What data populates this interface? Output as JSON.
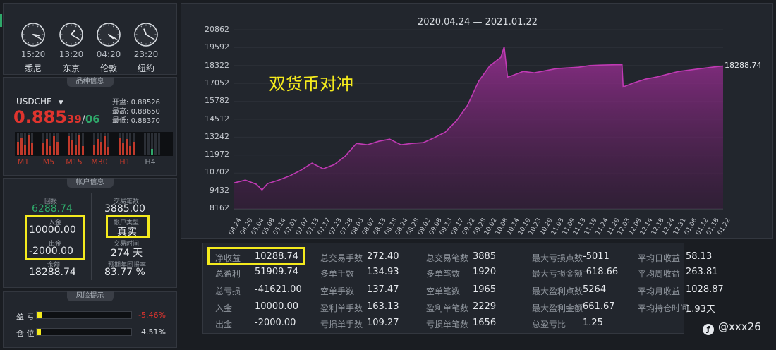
{
  "clocks": [
    {
      "time": "15:20",
      "city": "悉尼",
      "hour": 15,
      "minute": 20
    },
    {
      "time": "13:20",
      "city": "东京",
      "hour": 13,
      "minute": 20
    },
    {
      "time": "04:20",
      "city": "伦敦",
      "hour": 4,
      "minute": 20
    },
    {
      "time": "23:20",
      "city": "纽约",
      "hour": 23,
      "minute": 20
    }
  ],
  "symbol_section": {
    "title": "品种信息",
    "symbol": "USDCHF",
    "price_big": "0.885",
    "price_small": "39",
    "price_sep": "/",
    "price_spread": "06",
    "open_label": "开盘:",
    "open_value": "0.88526",
    "high_label": "最高:",
    "high_value": "0.88650",
    "low_label": "最低:",
    "low_value": "0.88370",
    "timeframes": [
      "M1",
      "M5",
      "M15",
      "M30",
      "H1",
      "H4"
    ]
  },
  "account_section": {
    "title": "帐户信息",
    "return_label": "回报",
    "return_value": "6288.74",
    "trades_label": "交易笔数",
    "trades_value": "3885.00",
    "deposit_label": "入金",
    "deposit_value": "10000.00",
    "account_type_label": "帐户类型",
    "account_type_value": "真实",
    "withdraw_label": "出金",
    "withdraw_value": "-2000.00",
    "duration_label": "交易时间",
    "duration_value": "274 天",
    "balance_label": "余额",
    "balance_value": "18288.74",
    "annual_label": "预期年回报率",
    "annual_value": "83.77 %"
  },
  "risk_section": {
    "title": "风险提示",
    "items": [
      {
        "label": "盈 亏",
        "value": "-5.46%",
        "fraction": 0.0546,
        "color": "#e0342e"
      },
      {
        "label": "仓 位",
        "value": "4.51%",
        "fraction": 0.0451,
        "color": "#d7dbe0"
      }
    ]
  },
  "chart_title": "2020.04.24 — 2021.01.22",
  "chart_overlay_text": "双货币对冲",
  "chart_data": {
    "type": "area",
    "title": "2020.04.24 — 2021.01.22",
    "yticks": [
      "20862",
      "19592",
      "18322",
      "17052",
      "15782",
      "14512",
      "13242",
      "11972",
      "10702",
      "9432",
      "8162"
    ],
    "ylim": [
      8162,
      20862
    ],
    "last_value_label": "18288.74",
    "xticks": [
      "04.24",
      "04.29",
      "05.04",
      "05.08",
      "05.14",
      "07.01",
      "07.07",
      "07.13",
      "07.17",
      "07.23",
      "07.28",
      "08.03",
      "08.07",
      "08.13",
      "08.18",
      "08.24",
      "08.28",
      "09.02",
      "09.08",
      "09.13",
      "09.17",
      "09.22",
      "09.28",
      "10.02",
      "10.08",
      "10.14",
      "10.19",
      "10.23",
      "10.29",
      "11.03",
      "11.09",
      "11.13",
      "11.19",
      "11.24",
      "11.29",
      "12.03",
      "12.09",
      "12.14",
      "12.18",
      "12.24",
      "12.31",
      "01.06",
      "01.12",
      "01.18",
      "01.22"
    ],
    "x": [
      0,
      1,
      2,
      2.5,
      3,
      4,
      5,
      6,
      7,
      8,
      9,
      10,
      11,
      12,
      13,
      14,
      15,
      16,
      17,
      18,
      19,
      20,
      21,
      22,
      23,
      24,
      24.3,
      24.6,
      25,
      26,
      27,
      28,
      29,
      30,
      31,
      32,
      33,
      34,
      34.9,
      35,
      36,
      37,
      38,
      39,
      40,
      41,
      42,
      43,
      44
    ],
    "values": [
      10000,
      10200,
      9900,
      9500,
      9950,
      10200,
      10500,
      10900,
      11400,
      11000,
      11300,
      11900,
      12800,
      12700,
      12950,
      13100,
      12700,
      12800,
      12850,
      13200,
      13600,
      14400,
      15500,
      17200,
      18300,
      18900,
      19650,
      17500,
      17600,
      17900,
      17800,
      17950,
      18100,
      18150,
      18200,
      18320,
      18350,
      18370,
      18380,
      16800,
      17100,
      17350,
      17500,
      17700,
      17900,
      18000,
      18100,
      18200,
      18288.74
    ],
    "line_color": "#c03ab4"
  },
  "stats": [
    [
      {
        "label": "净收益",
        "value": "10288.74"
      },
      {
        "label": "总盈利",
        "value": "51909.74"
      },
      {
        "label": "总亏损",
        "value": "-41621.00"
      },
      {
        "label": "入金",
        "value": "10000.00"
      },
      {
        "label": "出金",
        "value": "-2000.00"
      }
    ],
    [
      {
        "label": "总交易手数",
        "value": "272.40"
      },
      {
        "label": "多单手数",
        "value": "134.93"
      },
      {
        "label": "空单手数",
        "value": "137.47"
      },
      {
        "label": "盈利单手数",
        "value": "163.13"
      },
      {
        "label": "亏损单手数",
        "value": "109.27"
      }
    ],
    [
      {
        "label": "总交易笔数",
        "value": "3885"
      },
      {
        "label": "多单笔数",
        "value": "1920"
      },
      {
        "label": "空单笔数",
        "value": "1965"
      },
      {
        "label": "盈利单笔数",
        "value": "2229"
      },
      {
        "label": "亏损单笔数",
        "value": "1656"
      }
    ],
    [
      {
        "label": "最大亏损点数",
        "value": "-5011"
      },
      {
        "label": "最大亏损金额",
        "value": "-618.66"
      },
      {
        "label": "最大盈利点数",
        "value": "5264"
      },
      {
        "label": "最大盈利金额",
        "value": "661.67"
      },
      {
        "label": "总盈亏比",
        "value": "1.25"
      }
    ],
    [
      {
        "label": "平均日收益",
        "value": "58.13"
      },
      {
        "label": "平均周收益",
        "value": "263.81"
      },
      {
        "label": "平均月收益",
        "value": "1028.87"
      },
      {
        "label": "平均持仓时间",
        "value": "1.93天"
      }
    ]
  ],
  "watermark": "@xxx26",
  "colors": {
    "highlight": "#f4ea1d",
    "price_red": "#e0342e",
    "price_green": "#2fa86a",
    "return_green": "#2fa86a"
  }
}
